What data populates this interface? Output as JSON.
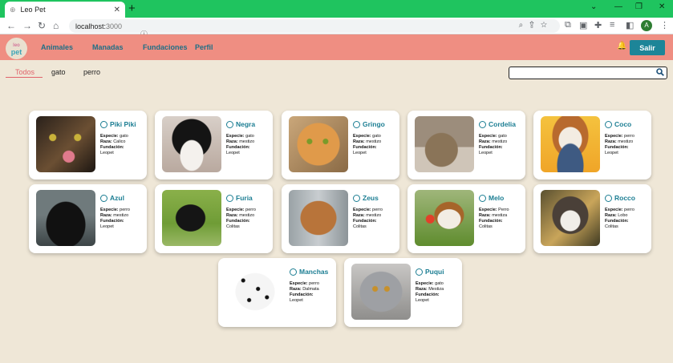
{
  "browser": {
    "tab_title": "Leo Pet",
    "url_host": "localhost:",
    "url_port": "3000",
    "profile_initial": "A"
  },
  "nav": {
    "logo_top": "leo",
    "logo_bottom": "pet",
    "links": [
      "Animales",
      "Manadas",
      "Fundaciones",
      "Perfil"
    ],
    "logout": "Salir"
  },
  "filters": [
    "Todos",
    "gato",
    "perro"
  ],
  "search": {
    "value": ""
  },
  "labels": {
    "species": "Especie:",
    "breed": "Raza:",
    "foundation": "Fundación:"
  },
  "pets": [
    {
      "name": "Piki Piki",
      "species": "gato",
      "breed": "Calico",
      "foundation": "Leopet"
    },
    {
      "name": "Negra",
      "species": "gato",
      "breed": "mestizo",
      "foundation": "Leopet"
    },
    {
      "name": "Gringo",
      "species": "gato",
      "breed": "mestizo",
      "foundation": "Leopet"
    },
    {
      "name": "Cordelia",
      "species": "gato",
      "breed": "mestizo",
      "foundation": "Leopet"
    },
    {
      "name": "Coco",
      "species": "perro",
      "breed": "mestizo",
      "foundation": "Leopet"
    },
    {
      "name": "Azul",
      "species": "perro",
      "breed": "mestizo",
      "foundation": "Leopet"
    },
    {
      "name": "Furia",
      "species": "perro",
      "breed": "mestizo",
      "foundation": "Colitas"
    },
    {
      "name": "Zeus",
      "species": "perro",
      "breed": "mestizo",
      "foundation": "Colitas"
    },
    {
      "name": "Melo",
      "species": "Perro",
      "breed": "mestiza",
      "foundation": "Colitas"
    },
    {
      "name": "Rocco",
      "species": "perro",
      "breed": "Lobo",
      "foundation": "Colitas"
    },
    {
      "name": "Manchas",
      "species": "perro",
      "breed": "Dalmata",
      "foundation": "Leopet"
    },
    {
      "name": "Puqui",
      "species": "gato",
      "breed": "Mestiza",
      "foundation": "Leopet"
    }
  ],
  "colors": {
    "navbar": "#ef8e82",
    "page_bg": "#efe7d7",
    "accent": "#1c7e93",
    "tabbar": "#1fc45f"
  }
}
